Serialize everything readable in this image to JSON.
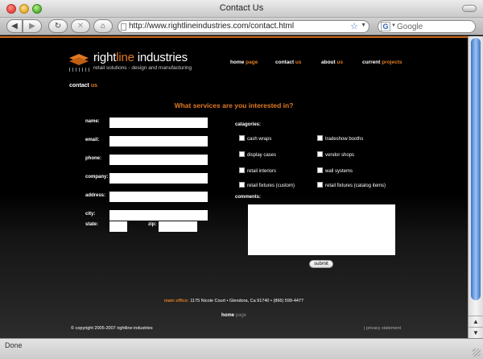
{
  "window": {
    "title": "Contact Us"
  },
  "toolbar": {
    "back_glyph": "◀",
    "forward_glyph": "▶",
    "reload_glyph": "↻",
    "stop_glyph": "✕",
    "home_glyph": "⌂",
    "url": "http://www.rightlineindustries.com/contact.html",
    "search_placeholder": "Google"
  },
  "logo": {
    "name_prefix": "right",
    "name_highlight": "line",
    "name_suffix": " industries",
    "tagline": "retail solutions - design and manufacturing"
  },
  "nav": [
    {
      "main": "home",
      "sub": " page"
    },
    {
      "main": "contact",
      "sub": " us"
    },
    {
      "main": "about",
      "sub": " us"
    },
    {
      "main": "current",
      "sub": " projects"
    }
  ],
  "page": {
    "heading_main": "contact",
    "heading_sub": " us",
    "services_heading": "What services are you interested in?"
  },
  "form": {
    "fields": [
      {
        "label": "name:",
        "value": ""
      },
      {
        "label": "email:",
        "value": ""
      },
      {
        "label": "phone:",
        "value": ""
      },
      {
        "label": "company:",
        "value": ""
      },
      {
        "label": "address:",
        "value": ""
      },
      {
        "label": "city:",
        "value": ""
      }
    ],
    "state_label": "state:",
    "zip_label": "zip:",
    "categories_label": "catagories:",
    "categories": [
      "cash wraps",
      "tradeshow booths",
      "display cases",
      "vendor shops",
      "retail interiors",
      "wall systems",
      "retail fixtures (custom)",
      "retail fixtures (catalog items)"
    ],
    "comments_label": "comments:",
    "submit_label": "submit"
  },
  "footer": {
    "office_label": "main office:",
    "office_address": " 1175 Nicole Court • Glendora, Ca 91740 •  (866) 599-4477",
    "home_main": "home",
    "home_sub": " page",
    "copyright": "© copyright 2005-2007 rightline industries",
    "privacy": "|   privacy statement"
  },
  "status": {
    "text": "Done"
  },
  "colors": {
    "accent": "#e07a24",
    "background": "#000000",
    "scroll_thumb": "#3f74c7"
  }
}
